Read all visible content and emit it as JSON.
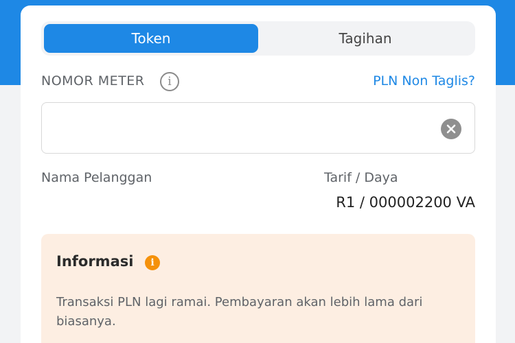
{
  "tabs": [
    {
      "label": "Token",
      "active": true
    },
    {
      "label": "Tagihan",
      "active": false
    }
  ],
  "meter": {
    "label": "NOMOR METER",
    "info_icon": "info-outline-icon",
    "value": "",
    "clear_icon": "clear-circle-icon"
  },
  "non_taglis_link": "PLN Non Taglis?",
  "customer": {
    "name_label": "Nama Pelanggan",
    "name_value": ""
  },
  "tarif": {
    "label": "Tarif / Daya",
    "value": "R1 / 000002200 VA"
  },
  "info": {
    "title": "Informasi",
    "icon": "info-filled-icon",
    "text": "Transaksi PLN lagi ramai. Pembayaran akan lebih lama dari biasanya."
  },
  "colors": {
    "primary": "#1e88e5",
    "info_bg": "#fdeee2",
    "info_icon": "#f5910a"
  }
}
